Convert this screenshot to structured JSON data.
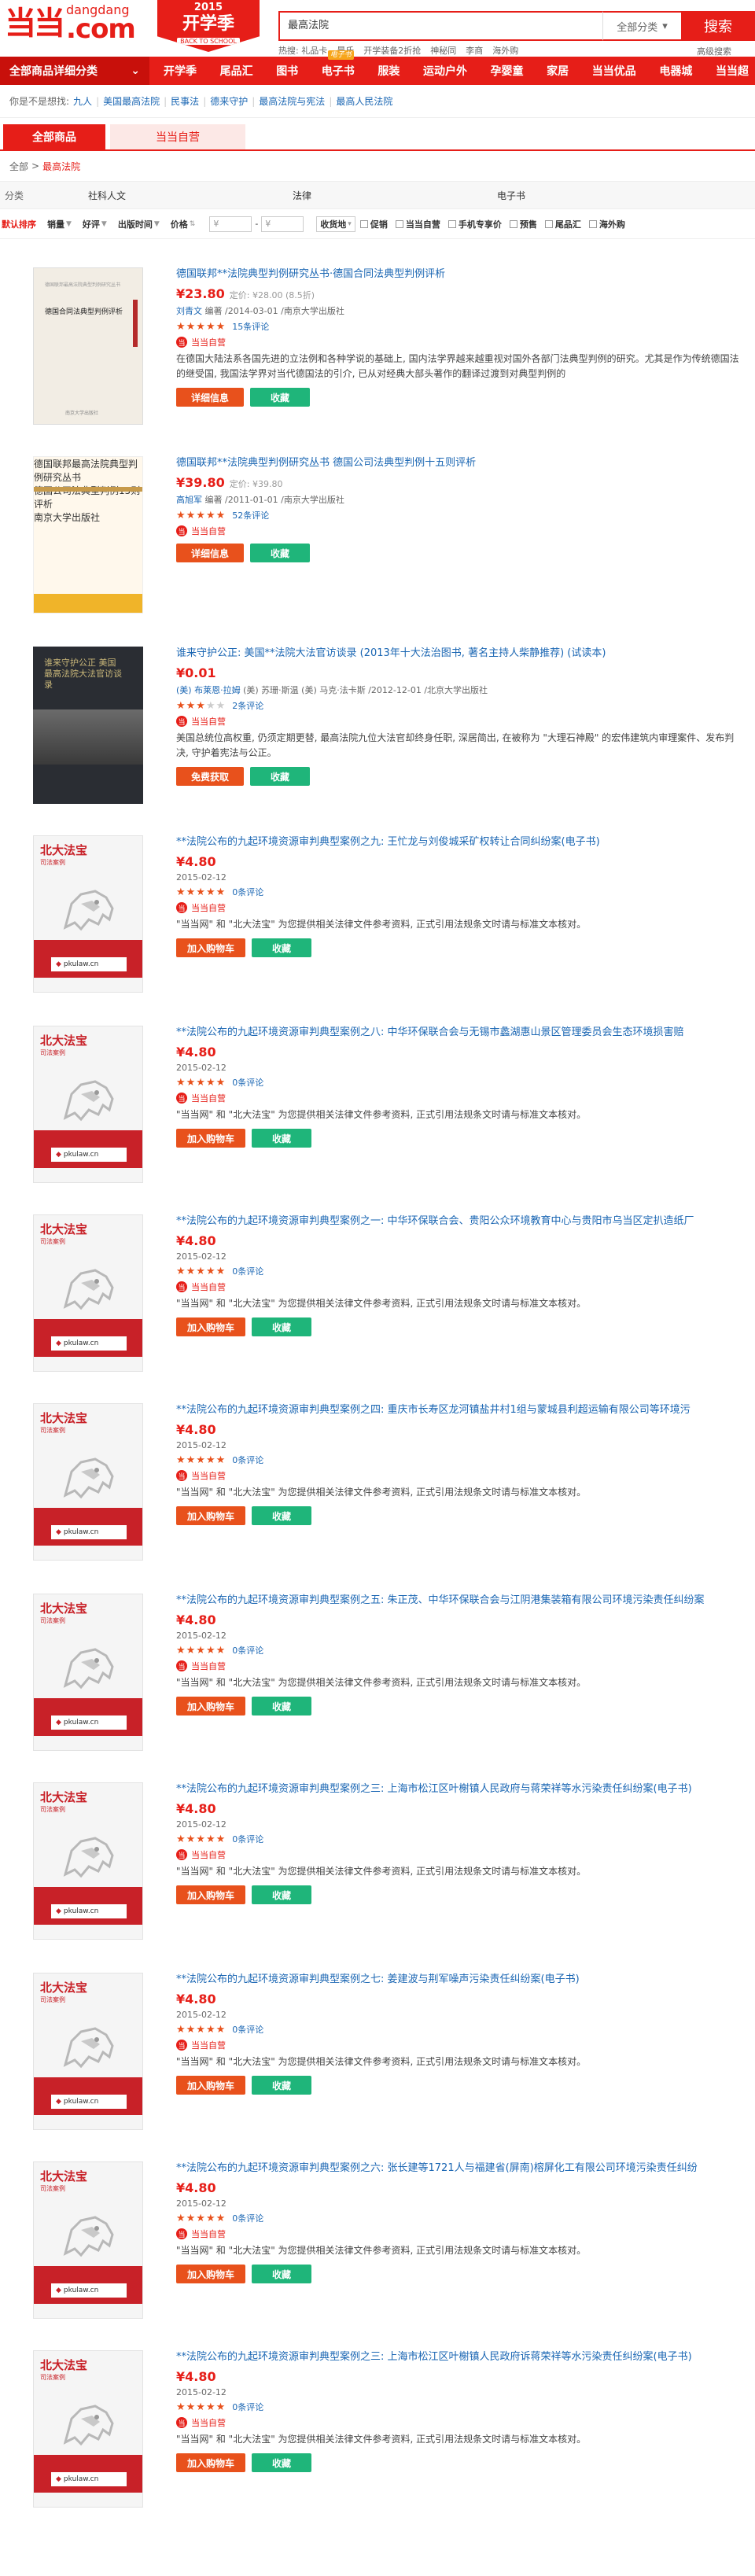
{
  "logo": {
    "mark": "当当",
    "en": "dangdang",
    "com": ".com"
  },
  "promo": {
    "year": "2015",
    "title": "开学季",
    "sub": "BACK TO SCHOOL"
  },
  "search": {
    "value": "最高法院",
    "category": "全部分类",
    "button": "搜索",
    "advanced": "高级搜索"
  },
  "hotwords": [
    "热搜: 礼品卡",
    "晨氏",
    "开学装备2折抢",
    "神秘同",
    "李商",
    "海外购"
  ],
  "nav": {
    "all_categories": "全部商品详细分类",
    "items": [
      "开学季",
      "尾品汇",
      "图书",
      "电子书",
      "服装",
      "运动户外",
      "孕婴童",
      "家居",
      "当当优品",
      "电器城",
      "当当超"
    ],
    "ebook_tag": "电子书"
  },
  "guess": {
    "label": "你是不是想找:",
    "links": [
      "九人",
      "美国最高法院",
      "民事法",
      "德来守护",
      "最高法院与宪法",
      "最高人民法院"
    ]
  },
  "tabs": {
    "all": "全部商品",
    "self": "当当自营"
  },
  "breadcrumb": {
    "root": "全部",
    "sep": ">",
    "current": "最高法院"
  },
  "filter": {
    "label": "分类",
    "options": [
      "社科人文",
      "法律",
      "电子书"
    ]
  },
  "sortbar": {
    "default": "默认排序",
    "sales": "销量",
    "praise": "好评",
    "pubtime": "出版时间",
    "price": "价格",
    "price_from": "¥",
    "price_to": "¥",
    "ship": "收货地",
    "checks": [
      "促销",
      "当当自营",
      "手机专享价",
      "预售",
      "尾品汇",
      "海外购"
    ]
  },
  "products": [
    {
      "title": "德国联邦**法院典型判例研究丛书·德国合同法典型判例评析",
      "price": "¥23.80",
      "orig": "定价: ¥28.00 (8.5折)",
      "author": "刘青文",
      "pub": "编著 /2014-03-01 /南京大学出版社",
      "stars": 5,
      "comments": "15条评论",
      "self": "当当自营",
      "desc": "在德国大陆法系各国先进的立法例和各种学说的基础上, 国内法学界越来越重视对国外各部门法典型判例的研究。尤其是作为传统德国法的继受国, 我国法学界对当代德国法的引介, 已从对经典大部头著作的翻译过渡到对典型判例的",
      "btn1": "详细信息",
      "btn2": "收藏"
    },
    {
      "title": "德国联邦**法院典型判例研究丛书 德国公司法典型判例十五则评析",
      "price": "¥39.80",
      "orig": "定价: ¥39.80",
      "author": "高旭军",
      "pub": "编著 /2011-01-01 /南京大学出版社",
      "stars": 5,
      "comments": "52条评论",
      "self": "当当自营",
      "desc": "",
      "btn1": "详细信息",
      "btn2": "收藏"
    },
    {
      "title": "谁来守护公正: 美国**法院大法官访谈录 (2013年十大法治图书, 著名主持人柴静推荐) (试读本)",
      "price": "¥0.01",
      "orig": "",
      "author": "(美) 布莱恩·拉姆",
      "pub": "(美) 苏珊·斯温 (美) 马克·法卡斯 /2012-12-01 /北京大学出版社",
      "stars": 3,
      "comments": "2条评论",
      "self": "当当自营",
      "desc": "美国总统位高权重, 仍须定期更替, 最高法院九位大法官却终身任职, 深居简出, 在被称为 \"大理石神殿\" 的宏伟建筑内审理案件、发布判决, 守护着宪法与公正。",
      "btn1": "免费获取",
      "btn2": "收藏"
    },
    {
      "title": "**法院公布的九起环境资源审判典型案例之九: 王忙龙与刘俊城采矿权转让合同纠纷案(电子书)",
      "price": "¥4.80",
      "date": "2015-02-12",
      "stars": 5,
      "comments": "0条评论",
      "self": "当当自营",
      "desc": "\"当当网\" 和 \"北大法宝\" 为您提供相关法律文件参考资料, 正式引用法规条文时请与标准文本核对。",
      "btn1": "加入购物车",
      "btn2": "收藏"
    },
    {
      "title": "**法院公布的九起环境资源审判典型案例之八: 中华环保联合会与无锡市蠡湖惠山景区管理委员会生态环境损害赔",
      "price": "¥4.80",
      "date": "2015-02-12",
      "stars": 5,
      "comments": "0条评论",
      "self": "当当自营",
      "desc": "\"当当网\" 和 \"北大法宝\" 为您提供相关法律文件参考资料, 正式引用法规条文时请与标准文本核对。",
      "btn1": "加入购物车",
      "btn2": "收藏"
    },
    {
      "title": "**法院公布的九起环境资源审判典型案例之一: 中华环保联合会、贵阳公众环境教育中心与贵阳市乌当区定扒造纸厂",
      "price": "¥4.80",
      "date": "2015-02-12",
      "stars": 5,
      "comments": "0条评论",
      "self": "当当自营",
      "desc": "\"当当网\" 和 \"北大法宝\" 为您提供相关法律文件参考资料, 正式引用法规条文时请与标准文本核对。",
      "btn1": "加入购物车",
      "btn2": "收藏"
    },
    {
      "title": "**法院公布的九起环境资源审判典型案例之四: 重庆市长寿区龙河镇盐井村1组与蒙城县利超运输有限公司等环境污",
      "price": "¥4.80",
      "date": "2015-02-12",
      "stars": 5,
      "comments": "0条评论",
      "self": "当当自营",
      "desc": "\"当当网\" 和 \"北大法宝\" 为您提供相关法律文件参考资料, 正式引用法规条文时请与标准文本核对。",
      "btn1": "加入购物车",
      "btn2": "收藏"
    },
    {
      "title": "**法院公布的九起环境资源审判典型案例之五: 朱正茂、中华环保联合会与江阴港集装箱有限公司环境污染责任纠纷案",
      "price": "¥4.80",
      "date": "2015-02-12",
      "stars": 5,
      "comments": "0条评论",
      "self": "当当自营",
      "desc": "\"当当网\" 和 \"北大法宝\" 为您提供相关法律文件参考资料, 正式引用法规条文时请与标准文本核对。",
      "btn1": "加入购物车",
      "btn2": "收藏"
    },
    {
      "title": "**法院公布的九起环境资源审判典型案例之三: 上海市松江区叶榭镇人民政府与蒋荣祥等水污染责任纠纷案(电子书)",
      "price": "¥4.80",
      "date": "2015-02-12",
      "stars": 5,
      "comments": "0条评论",
      "self": "当当自营",
      "desc": "\"当当网\" 和 \"北大法宝\" 为您提供相关法律文件参考资料, 正式引用法规条文时请与标准文本核对。",
      "btn1": "加入购物车",
      "btn2": "收藏"
    },
    {
      "title": "**法院公布的九起环境资源审判典型案例之七: 姜建波与荆军噪声污染责任纠纷案(电子书)",
      "price": "¥4.80",
      "date": "2015-02-12",
      "stars": 5,
      "comments": "0条评论",
      "self": "当当自营",
      "desc": "\"当当网\" 和 \"北大法宝\" 为您提供相关法律文件参考资料, 正式引用法规条文时请与标准文本核对。",
      "btn1": "加入购物车",
      "btn2": "收藏"
    },
    {
      "title": "**法院公布的九起环境资源审判典型案例之六: 张长建等1721人与福建省(屏南)榕屏化工有限公司环境污染责任纠纷",
      "price": "¥4.80",
      "date": "2015-02-12",
      "stars": 5,
      "comments": "0条评论",
      "self": "当当自营",
      "desc": "\"当当网\" 和 \"北大法宝\" 为您提供相关法律文件参考资料, 正式引用法规条文时请与标准文本核对。",
      "btn1": "加入购物车",
      "btn2": "收藏"
    },
    {
      "title": "**法院公布的九起环境资源审判典型案例之三: 上海市松江区叶榭镇人民政府诉蒋荣祥等水污染责任纠纷案(电子书)",
      "price": "¥4.80",
      "date": "2015-02-12",
      "stars": 5,
      "comments": "0条评论",
      "self": "当当自营",
      "desc": "\"当当网\" 和 \"北大法宝\" 为您提供相关法律文件参考资料, 正式引用法规条文时请与标准文本核对。",
      "btn1": "加入购物车",
      "btn2": "收藏"
    }
  ],
  "covers": {
    "book1": {
      "head": "德国联邦最高法院典型判例研究丛书",
      "title": "德国合同法典型判例评析",
      "footer": "南京大学出版社"
    },
    "book2": {
      "head": "德国联邦最高法院典型判例研究丛书",
      "title": "德国公司法典型判例15则评析",
      "footer": "南京大学出版社"
    },
    "book3": {
      "title": "谁来守护公正 美国最高法院大法官访谈录"
    },
    "pku": {
      "brand": "北大法宝",
      "sub": "司法案例",
      "url": "pkulaw.cn"
    }
  },
  "colors": {
    "brand": "#e61e18",
    "green": "#1fb57a",
    "orange": "#e8511c",
    "link": "#1a66b3"
  }
}
